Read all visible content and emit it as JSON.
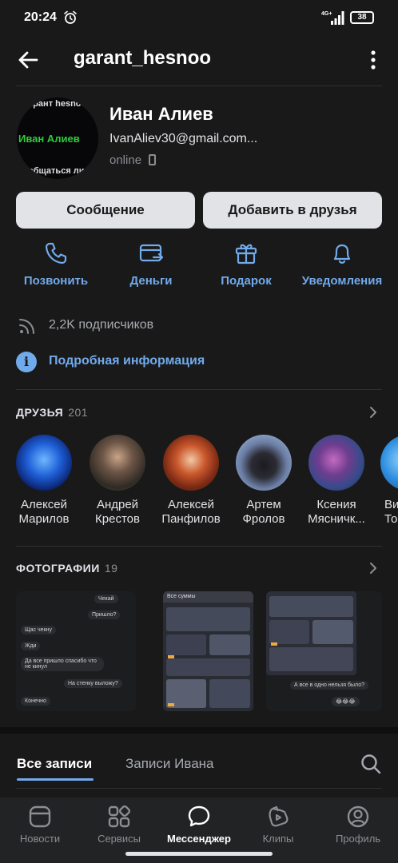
{
  "status_bar": {
    "time": "20:24",
    "network": "4G+",
    "battery": "38"
  },
  "header": {
    "title": "garant_hesnoo"
  },
  "profile": {
    "name": "Иван Алиев",
    "status": "IvanAliev30@gmail.com...",
    "online": "online",
    "avatar_text": {
      "line1": "Гарант hesnoo",
      "line2": "Иван Алиев",
      "line3": "общаться ли"
    }
  },
  "buttons": {
    "message": "Сообщение",
    "add_friend": "Добавить в друзья"
  },
  "actions": [
    {
      "label": "Позвонить",
      "icon": "phone-icon"
    },
    {
      "label": "Деньги",
      "icon": "money-transfer-icon"
    },
    {
      "label": "Подарок",
      "icon": "gift-icon"
    },
    {
      "label": "Уведомления",
      "icon": "bell-icon"
    }
  ],
  "subscribers": {
    "text": "2,2K подписчиков"
  },
  "details": {
    "text": "Подробная информация"
  },
  "friends": {
    "title": "ДРУЗЬЯ",
    "count": "201",
    "items": [
      {
        "first": "Алексей",
        "last": "Марилов"
      },
      {
        "first": "Андрей",
        "last": "Крестов"
      },
      {
        "first": "Алексей",
        "last": "Панфилов"
      },
      {
        "first": "Артем",
        "last": "Фролов"
      },
      {
        "first": "Ксения",
        "last": "Мясничк..."
      },
      {
        "first": "Ви",
        "last": "Топ"
      }
    ]
  },
  "photos": {
    "title": "ФОТОГРАФИИ",
    "count": "19",
    "chat1": [
      "Чекай",
      "Пришло?",
      "Щас чекну",
      "Жди",
      "Да все пришло спасибо что не кинул",
      "На стенку выложу?",
      "Конечно"
    ],
    "chat2": {
      "header": "Все суммы"
    },
    "chat3": {
      "bubble1": "А все в одно нельзя было?",
      "bubble2": "😂😂😂"
    }
  },
  "tabs": {
    "all": "Все записи",
    "ivan": "Записи Ивана"
  },
  "bottom_nav": [
    {
      "label": "Новости",
      "icon": "news-icon",
      "active": false
    },
    {
      "label": "Сервисы",
      "icon": "services-icon",
      "active": false
    },
    {
      "label": "Мессенджер",
      "icon": "messenger-icon",
      "active": true
    },
    {
      "label": "Клипы",
      "icon": "clips-icon",
      "active": false
    },
    {
      "label": "Профиль",
      "icon": "profile-icon",
      "active": false
    }
  ],
  "colors": {
    "accent": "#71aaeb",
    "background": "#19191a",
    "button_bg": "#e1e3e6"
  }
}
